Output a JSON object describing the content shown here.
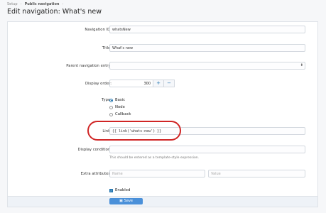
{
  "breadcrumb": {
    "items": [
      "Setup",
      "Public navigation"
    ]
  },
  "page": {
    "title": "Edit navigation: What's new"
  },
  "form": {
    "navigation_id": {
      "label": "Navigation ID:",
      "value": "whatsNew"
    },
    "title": {
      "label": "Title:",
      "value": "What's new"
    },
    "parent": {
      "label": "Parent navigation entry:",
      "value": ""
    },
    "display_order": {
      "label": "Display order:",
      "value": "300",
      "plus": "+",
      "minus": "−"
    },
    "type": {
      "label": "Type:",
      "options": [
        "Basic",
        "Node",
        "Callback"
      ],
      "selected": "Basic"
    },
    "link": {
      "label": "Link:",
      "value": "{{ link('whats-new') }}"
    },
    "display_condition": {
      "label": "Display condition:",
      "value": "",
      "hint": "This should be entered as a template-style expression."
    },
    "extra_attributes": {
      "label": "Extra attributes:",
      "name_placeholder": "Name",
      "value_placeholder": "Value"
    },
    "enabled": {
      "label": "Enabled",
      "checked": true
    },
    "save": {
      "label": "Save",
      "icon": "save-icon"
    }
  },
  "colors": {
    "accent": "#2577b1",
    "button": "#4a90d9",
    "annotation": "#d02525"
  }
}
